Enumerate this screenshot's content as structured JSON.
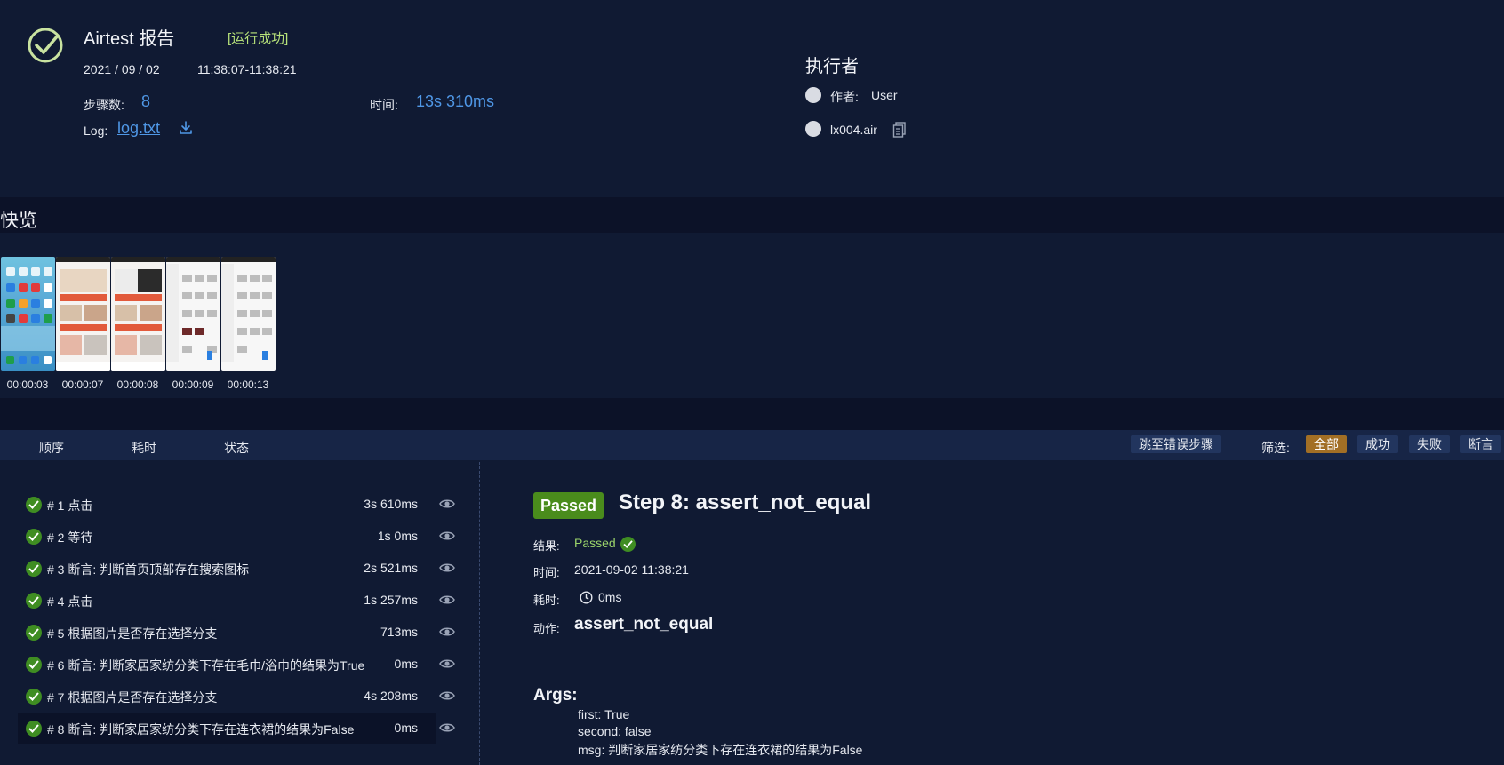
{
  "header": {
    "title": "Airtest 报告",
    "status": "[运行成功]",
    "date": "2021 / 09 / 02",
    "time_range": "11:38:07-11:38:21",
    "steps_label": "步骤数:",
    "steps_value": "8",
    "duration_label": "时间:",
    "duration_value": "13s 310ms",
    "log_label": "Log:",
    "log_link": "log.txt",
    "executor_title": "执行者",
    "author_label": "作者:",
    "author_value": "User",
    "script_name": "lx004.air"
  },
  "overview": {
    "title": "快览",
    "thumbnails": [
      {
        "time": "00:00:03",
        "theme": "home"
      },
      {
        "time": "00:00:07",
        "theme": "shop"
      },
      {
        "time": "00:00:08",
        "theme": "shop"
      },
      {
        "time": "00:00:09",
        "theme": "list"
      },
      {
        "time": "00:00:13",
        "theme": "list"
      }
    ]
  },
  "toolbar": {
    "col_order": "顺序",
    "col_duration": "耗时",
    "col_status": "状态",
    "jump_error": "跳至错误步骤",
    "filter_label": "筛选:",
    "filter_all": "全部",
    "filter_success": "成功",
    "filter_fail": "失败",
    "filter_assert": "断言"
  },
  "steps": [
    {
      "label": "# 1 点击",
      "time": "3s 610ms"
    },
    {
      "label": "# 2 等待",
      "time": "1s 0ms"
    },
    {
      "label": "# 3 断言: 判断首页顶部存在搜索图标",
      "time": "2s 521ms"
    },
    {
      "label": "# 4 点击",
      "time": "1s 257ms"
    },
    {
      "label": "# 5 根据图片是否存在选择分支",
      "time": "713ms"
    },
    {
      "label": "# 6 断言: 判断家居家纺分类下存在毛巾/浴巾的结果为True",
      "time": "0ms"
    },
    {
      "label": "# 7 根据图片是否存在选择分支",
      "time": "4s 208ms"
    },
    {
      "label": "# 8 断言: 判断家居家纺分类下存在连衣裙的结果为False",
      "time": "0ms"
    }
  ],
  "detail": {
    "badge": "Passed",
    "title": "Step 8: assert_not_equal",
    "result_label": "结果:",
    "result_value": "Passed",
    "time_label": "时间:",
    "time_value": "2021-09-02 11:38:21",
    "cost_label": "耗时:",
    "cost_value": "0ms",
    "action_label": "动作:",
    "action_value": "assert_not_equal",
    "args_title": "Args:",
    "args": [
      "first: True",
      "second: false",
      "msg: 判断家居家纺分类下存在连衣裙的结果为False"
    ]
  },
  "colors": {
    "background": "#101a33",
    "accent_blue": "#4f97e6",
    "success_green": "#3f8d22",
    "active_filter": "#a26f25"
  }
}
